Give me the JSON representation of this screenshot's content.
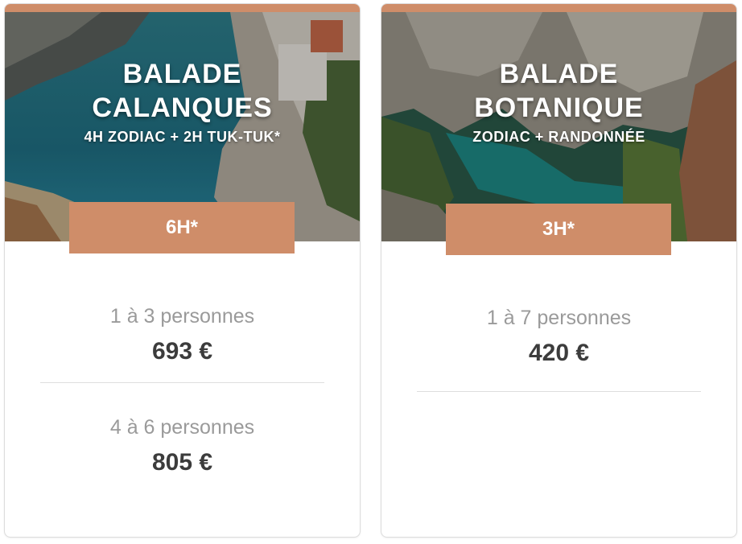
{
  "colors": {
    "accent": "#cf8d69",
    "title_text": "#ffffff",
    "people_text": "#9a9a9a",
    "price_text": "#3c3c3c",
    "separator": "#dedede"
  },
  "cards": [
    {
      "title_line1": "BALADE",
      "title_line2": "CALANQUES",
      "subtitle": "4H ZODIAC + 2H TUK-TUK*",
      "duration": "6H*",
      "tiers": [
        {
          "people": "1 à 3 personnes",
          "price": "693 €"
        },
        {
          "people": "4 à 6 personnes",
          "price": "805 €"
        }
      ]
    },
    {
      "title_line1": "BALADE",
      "title_line2": "BOTANIQUE",
      "subtitle": "ZODIAC + RANDONNÉE",
      "duration": "3H*",
      "tiers": [
        {
          "people": "1 à 7 personnes",
          "price": "420 €"
        }
      ]
    }
  ]
}
